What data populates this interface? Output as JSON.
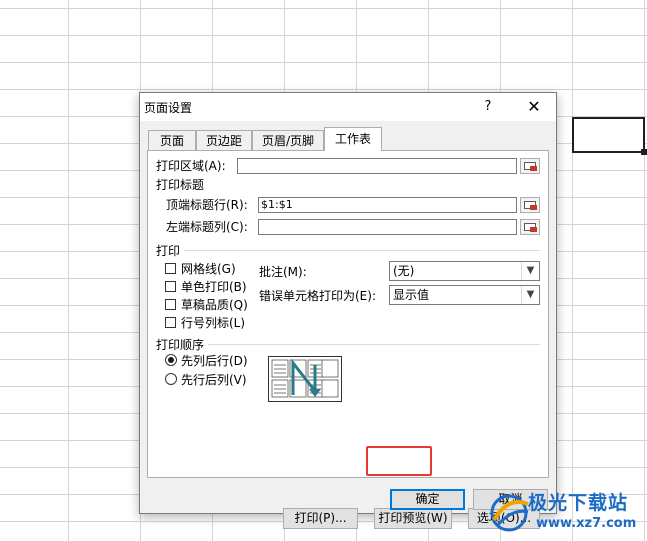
{
  "dialog": {
    "title": "页面设置",
    "help": "?",
    "close": "✕"
  },
  "tabs": [
    {
      "label": "页面"
    },
    {
      "label": "页边距"
    },
    {
      "label": "页眉/页脚"
    },
    {
      "label": "工作表",
      "active": true
    }
  ],
  "sheet": {
    "print_area_label": "打印区域(A):",
    "print_area_value": "",
    "print_titles_label": "打印标题",
    "rows_repeat_label": "顶端标题行(R):",
    "rows_repeat_value": "$1:$1",
    "cols_repeat_label": "左端标题列(C):",
    "cols_repeat_value": "",
    "print_section_label": "打印",
    "checkboxes": [
      {
        "label": "网格线(G)",
        "checked": false
      },
      {
        "label": "单色打印(B)",
        "checked": false
      },
      {
        "label": "草稿品质(Q)",
        "checked": false
      },
      {
        "label": "行号列标(L)",
        "checked": false
      }
    ],
    "comments_label": "批注(M):",
    "comments_value": "(无)",
    "errors_label": "错误单元格打印为(E):",
    "errors_value": "显示值",
    "order_label": "打印顺序",
    "order_options": [
      {
        "label": "先列后行(D)",
        "selected": true
      },
      {
        "label": "先行后列(V)",
        "selected": false
      }
    ]
  },
  "buttons": {
    "print": "打印(P)...",
    "preview": "打印预览(W)",
    "options": "选项(O)...",
    "ok": "确定",
    "cancel": "取消"
  },
  "colors": {
    "highlight": "#e53935",
    "default_button": "#0078d7",
    "watermark": "#1c6bc4"
  },
  "watermark": {
    "title": "极光下载站",
    "url": "www.xz7.com"
  }
}
